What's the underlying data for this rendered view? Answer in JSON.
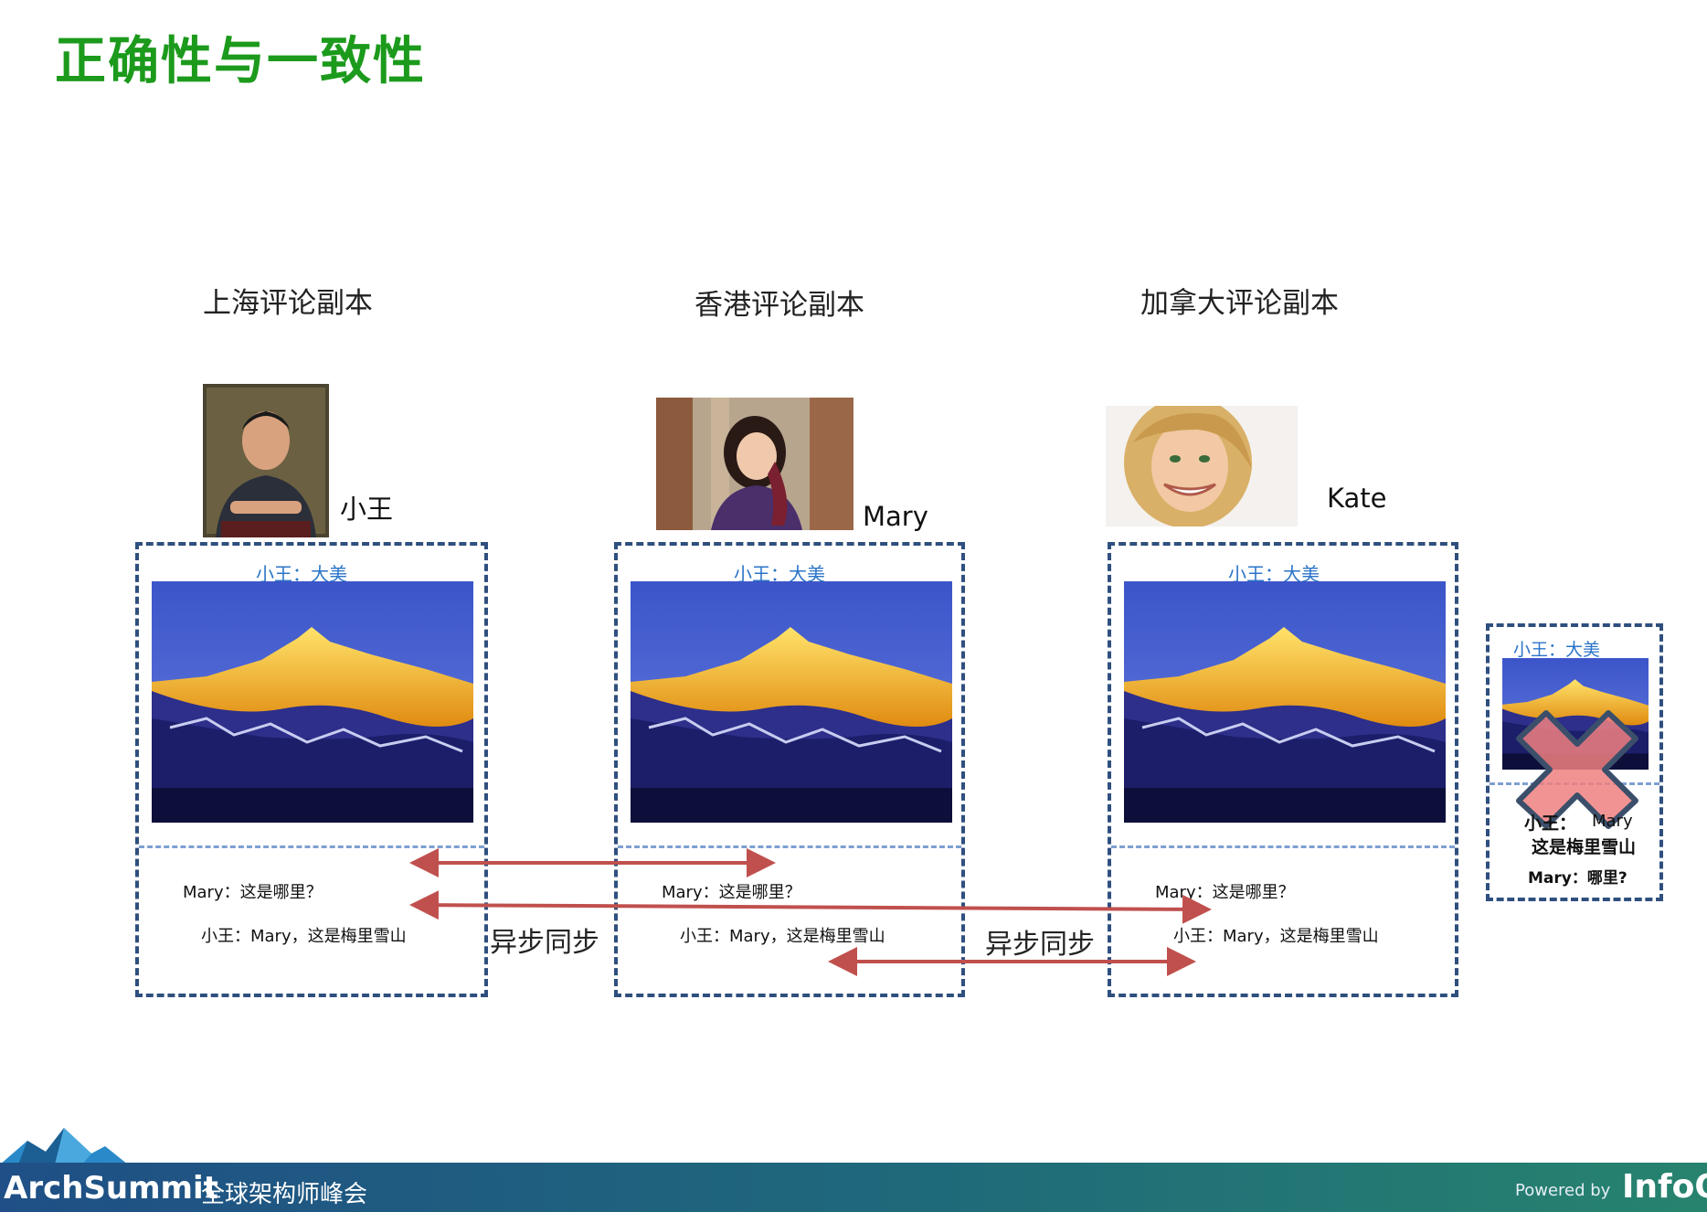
{
  "page": {
    "title": "正确性与一致性"
  },
  "replicas": [
    {
      "label": "上海评论副本",
      "person": "小王",
      "caption": "小王：大美",
      "comment1": "Mary：这是哪里？",
      "comment2": "小王：Mary，这是梅里雪山"
    },
    {
      "label": "香港评论副本",
      "person": "Mary",
      "caption": "小王：大美",
      "comment1": "Mary：这是哪里？",
      "comment2": "小王：Mary，这是梅里雪山"
    },
    {
      "label": "加拿大评论副本",
      "person": "Kate",
      "caption": "小王：大美",
      "comment1": "Mary：这是哪里？",
      "comment2": "小王：Mary，这是梅里雪山"
    }
  ],
  "wrong_replica": {
    "caption": "小王：大美",
    "line1a": "小王：",
    "line1b": "Mary",
    "line2": "这是梅里雪山",
    "line3": "Mary：哪里?"
  },
  "sync": [
    {
      "label": "异步同步"
    },
    {
      "label": "异步同步"
    }
  ],
  "footer": {
    "brand": "ArchSummit",
    "subtitle": "全球架构师峰会",
    "powered": "Powered by",
    "info": "InfoQ"
  },
  "colors": {
    "title_green": "#1c9a1c",
    "caption_blue": "#2a74c8",
    "box_border": "#2f4f7e",
    "arrow_red": "#c0504d",
    "cross_fill": "#f08080",
    "cross_stroke": "#3b4f6b"
  }
}
